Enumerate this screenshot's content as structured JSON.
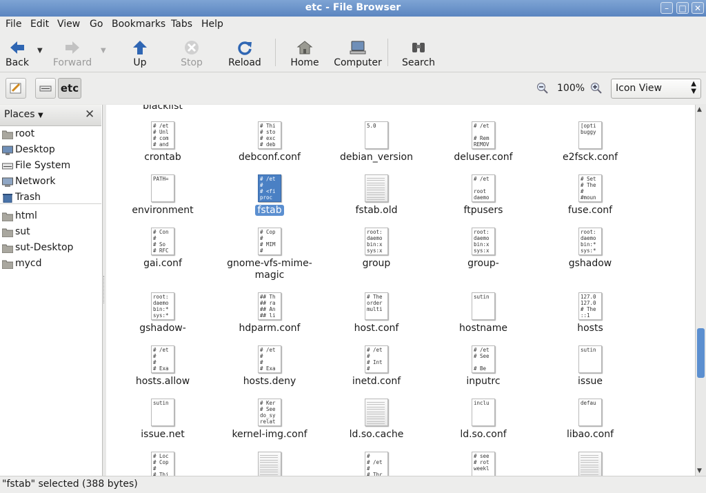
{
  "window": {
    "title": "etc - File Browser"
  },
  "menu": [
    "File",
    "Edit",
    "View",
    "Go",
    "Bookmarks",
    "Tabs",
    "Help"
  ],
  "toolbar": {
    "back": "Back",
    "forward": "Forward",
    "up": "Up",
    "stop": "Stop",
    "reload": "Reload",
    "home": "Home",
    "computer": "Computer",
    "search": "Search"
  },
  "location": {
    "current": "etc",
    "zoom": "100%",
    "view_mode": "Icon View"
  },
  "sidebar": {
    "header": "Places",
    "places": [
      "root",
      "Desktop",
      "File System",
      "Network",
      "Trash"
    ],
    "bookmarks": [
      "html",
      "sut",
      "sut-Desktop",
      "mycd"
    ]
  },
  "files": {
    "partial_top": "blacklist",
    "rows": [
      [
        {
          "name": "crontab",
          "preview": "# /et\n# Unl\n# com\n# and"
        },
        {
          "name": "debconf.conf",
          "preview": "# Thi\n# sto\n# exc\n# deb"
        },
        {
          "name": "debian_version",
          "preview": "5.0"
        },
        {
          "name": "deluser.conf",
          "preview": "# /et\n\n# Rem\nREMOV"
        },
        {
          "name": "e2fsck.conf",
          "preview": "[opti\nbuggy"
        }
      ],
      [
        {
          "name": "environment",
          "preview": "PATH="
        },
        {
          "name": "fstab",
          "preview": "# /et\n#\n# <fi\nproc"
        },
        {
          "name": "fstab.old",
          "preview": ""
        },
        {
          "name": "ftpusers",
          "preview": "# /et\n\nroot\ndaemo"
        },
        {
          "name": "fuse.conf",
          "preview": "# Set\n# The\n#\n#moun"
        }
      ],
      [
        {
          "name": "gai.conf",
          "preview": "# Con\n#\n# So\n# RFC"
        },
        {
          "name": "gnome-vfs-mime-magic",
          "preview": "# Cop\n#\n# MIM\n#"
        },
        {
          "name": "group",
          "preview": "root:\ndaemo\nbin:x\nsys:x"
        },
        {
          "name": "group-",
          "preview": "root:\ndaemo\nbin:x\nsys:x"
        },
        {
          "name": "gshadow",
          "preview": "root:\ndaemo\nbin:*\nsys:*"
        }
      ],
      [
        {
          "name": "gshadow-",
          "preview": "root:\ndaemo\nbin:*\nsys:*"
        },
        {
          "name": "hdparm.conf",
          "preview": "## Th\n## ra\n## An\n## li"
        },
        {
          "name": "host.conf",
          "preview": "# The\norder\nmulti"
        },
        {
          "name": "hostname",
          "preview": "sutin"
        },
        {
          "name": "hosts",
          "preview": "127.0\n127.0\n# The\n::1"
        }
      ],
      [
        {
          "name": "hosts.allow",
          "preview": "# /et\n#\n#\n# Exa"
        },
        {
          "name": "hosts.deny",
          "preview": "# /et\n#\n#\n# Exa"
        },
        {
          "name": "inetd.conf",
          "preview": "# /et\n#\n# Int\n#"
        },
        {
          "name": "inputrc",
          "preview": "# /et\n# See\n\n# Be"
        },
        {
          "name": "issue",
          "preview": "sutin"
        }
      ],
      [
        {
          "name": "issue.net",
          "preview": "sutin"
        },
        {
          "name": "kernel-img.conf",
          "preview": "# Ker\n# See\ndo_sy\nrelat"
        },
        {
          "name": "ld.so.cache",
          "preview": ""
        },
        {
          "name": "ld.so.conf",
          "preview": "inclu"
        },
        {
          "name": "libao.conf",
          "preview": "defau"
        }
      ],
      [
        {
          "name": "",
          "preview": "# Loc\n# Cop\n#\n# Thi"
        },
        {
          "name": "",
          "preview": ""
        },
        {
          "name": "",
          "preview": "#\n# /et\n#\n# Thr"
        },
        {
          "name": "",
          "preview": "# see\n# rot\nweekl"
        },
        {
          "name": "",
          "preview": ""
        }
      ]
    ]
  },
  "status": "\"fstab\" selected (388 bytes)",
  "colors": {
    "selection": "#4a80c4",
    "titlebar": "#6b93c9"
  }
}
